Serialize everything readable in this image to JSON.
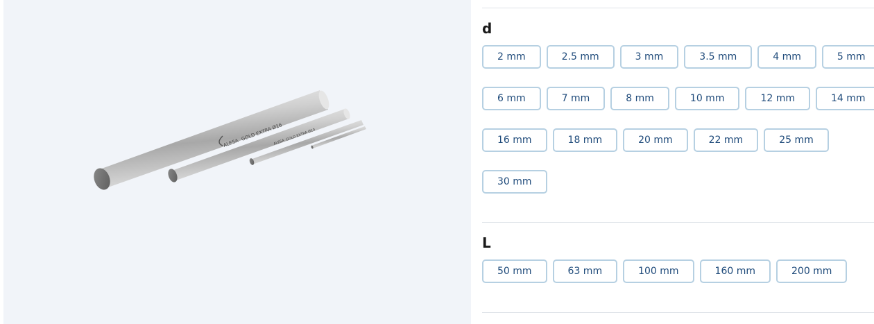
{
  "product_image": {
    "alt_icon": "carbide-rods-image",
    "engravings": {
      "large_rod": {
        "brand": "ALESA",
        "text": "GOLD EXTRA Ø16"
      },
      "medium_rod": {
        "brand": "ALESA",
        "text": "GOLD EXTRA Ø10"
      }
    }
  },
  "groups": {
    "d": {
      "title": "d",
      "rows": [
        [
          "2 mm",
          "2.5 mm",
          "3 mm",
          "3.5 mm",
          "4 mm",
          "5 mm"
        ],
        [
          "6 mm",
          "7 mm",
          "8 mm",
          "10 mm",
          "12 mm",
          "14 mm"
        ],
        [
          "16 mm",
          "18 mm",
          "20 mm",
          "22 mm",
          "25 mm"
        ],
        [
          "30 mm"
        ]
      ]
    },
    "L": {
      "title": "L",
      "rows": [
        [
          "50 mm",
          "63 mm",
          "100 mm",
          "160 mm",
          "200 mm"
        ]
      ]
    }
  },
  "colors": {
    "panel_bg": "#f1f4f9",
    "chip_border": "#b6d0e2",
    "chip_text": "#1e4a7a",
    "divider": "#dfe3e8"
  }
}
